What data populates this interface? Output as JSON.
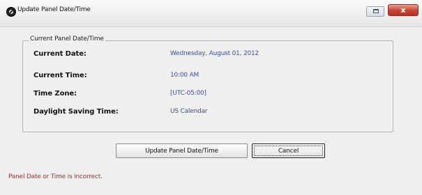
{
  "window": {
    "title": "Update Panel Date/Time",
    "restore_label": "",
    "close_label": "x"
  },
  "group": {
    "legend": "Current Panel Date/Time",
    "rows": [
      {
        "label": "Current Date:",
        "value": "Wednesday, August 01, 2012"
      },
      {
        "label": "Current Time:",
        "value": "10:00 AM"
      },
      {
        "label": "Time Zone:",
        "value": "[UTC-05:00]"
      },
      {
        "label": "Daylight Saving Time:",
        "value": "US Calendar"
      }
    ]
  },
  "buttons": {
    "update_label": "Update Panel Date/Time",
    "cancel_label": "Cancel"
  },
  "status": {
    "error_text": "Panel Date or Time is incorrect.",
    "error_color": "#d01b1b"
  },
  "colors": {
    "value_text": "#3a4f95",
    "close_button": "#c8422f"
  }
}
